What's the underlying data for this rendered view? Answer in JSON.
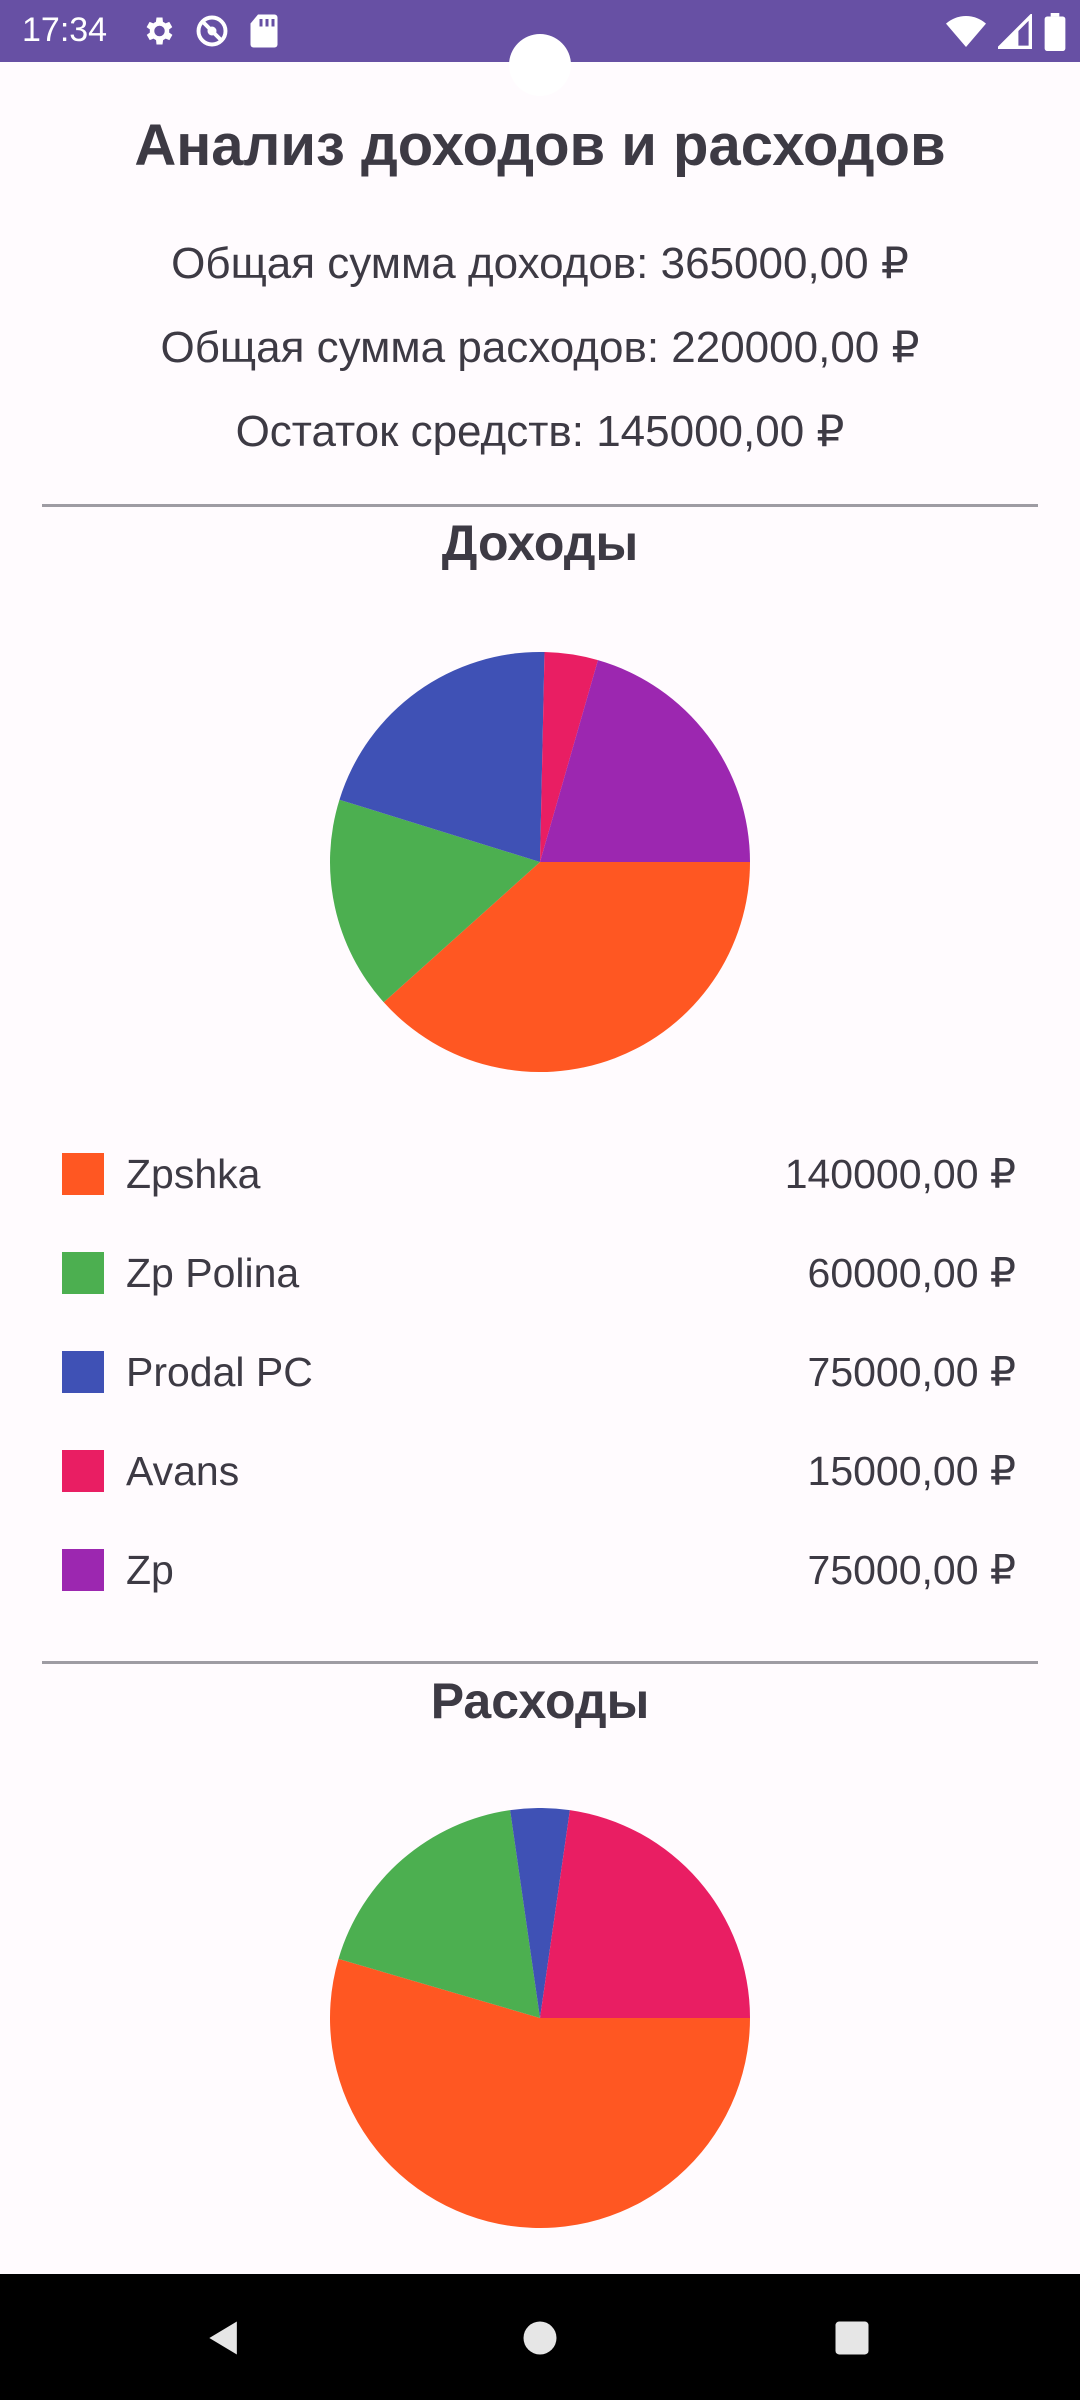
{
  "status_bar": {
    "time": "17:34",
    "icons_left": [
      "gear-icon",
      "do-not-disturb-icon",
      "sd-card-icon"
    ],
    "icons_right": [
      "wifi-icon",
      "signal-icon",
      "battery-icon"
    ],
    "background": "#6750a4"
  },
  "header": {
    "title": "Анализ доходов и расходов",
    "total_income": "Общая сумма доходов: 365000,00 ₽",
    "total_expense": "Общая сумма расходов: 220000,00 ₽",
    "balance": "Остаток средств: 145000,00 ₽"
  },
  "income": {
    "title": "Доходы",
    "items": [
      {
        "label": "Zpshka",
        "amount": "140000,00 ₽",
        "color": "#ff5722"
      },
      {
        "label": "Zp Polina",
        "amount": "60000,00 ₽",
        "color": "#4caf50"
      },
      {
        "label": "Prodal PC",
        "amount": "75000,00 ₽",
        "color": "#3f51b5"
      },
      {
        "label": "Avans",
        "amount": "15000,00 ₽",
        "color": "#e91e63"
      },
      {
        "label": "Zp",
        "amount": "75000,00 ₽",
        "color": "#9c27b0"
      }
    ]
  },
  "expenses": {
    "title": "Расходы"
  },
  "chart_data": [
    {
      "type": "pie",
      "categories": [
        "Zpshka",
        "Zp Polina",
        "Prodal PC",
        "Avans",
        "Zp"
      ],
      "values": [
        140000,
        60000,
        75000,
        15000,
        75000
      ],
      "colors": [
        "#ff5722",
        "#4caf50",
        "#3f51b5",
        "#e91e63",
        "#9c27b0"
      ]
    },
    {
      "type": "pie",
      "values": [
        120000,
        40000,
        10000,
        50000
      ],
      "colors": [
        "#ff5722",
        "#4caf50",
        "#3f51b5",
        "#e91e63"
      ]
    }
  ],
  "nav_bar": {
    "buttons": [
      "back-icon",
      "home-icon",
      "recents-icon"
    ]
  }
}
